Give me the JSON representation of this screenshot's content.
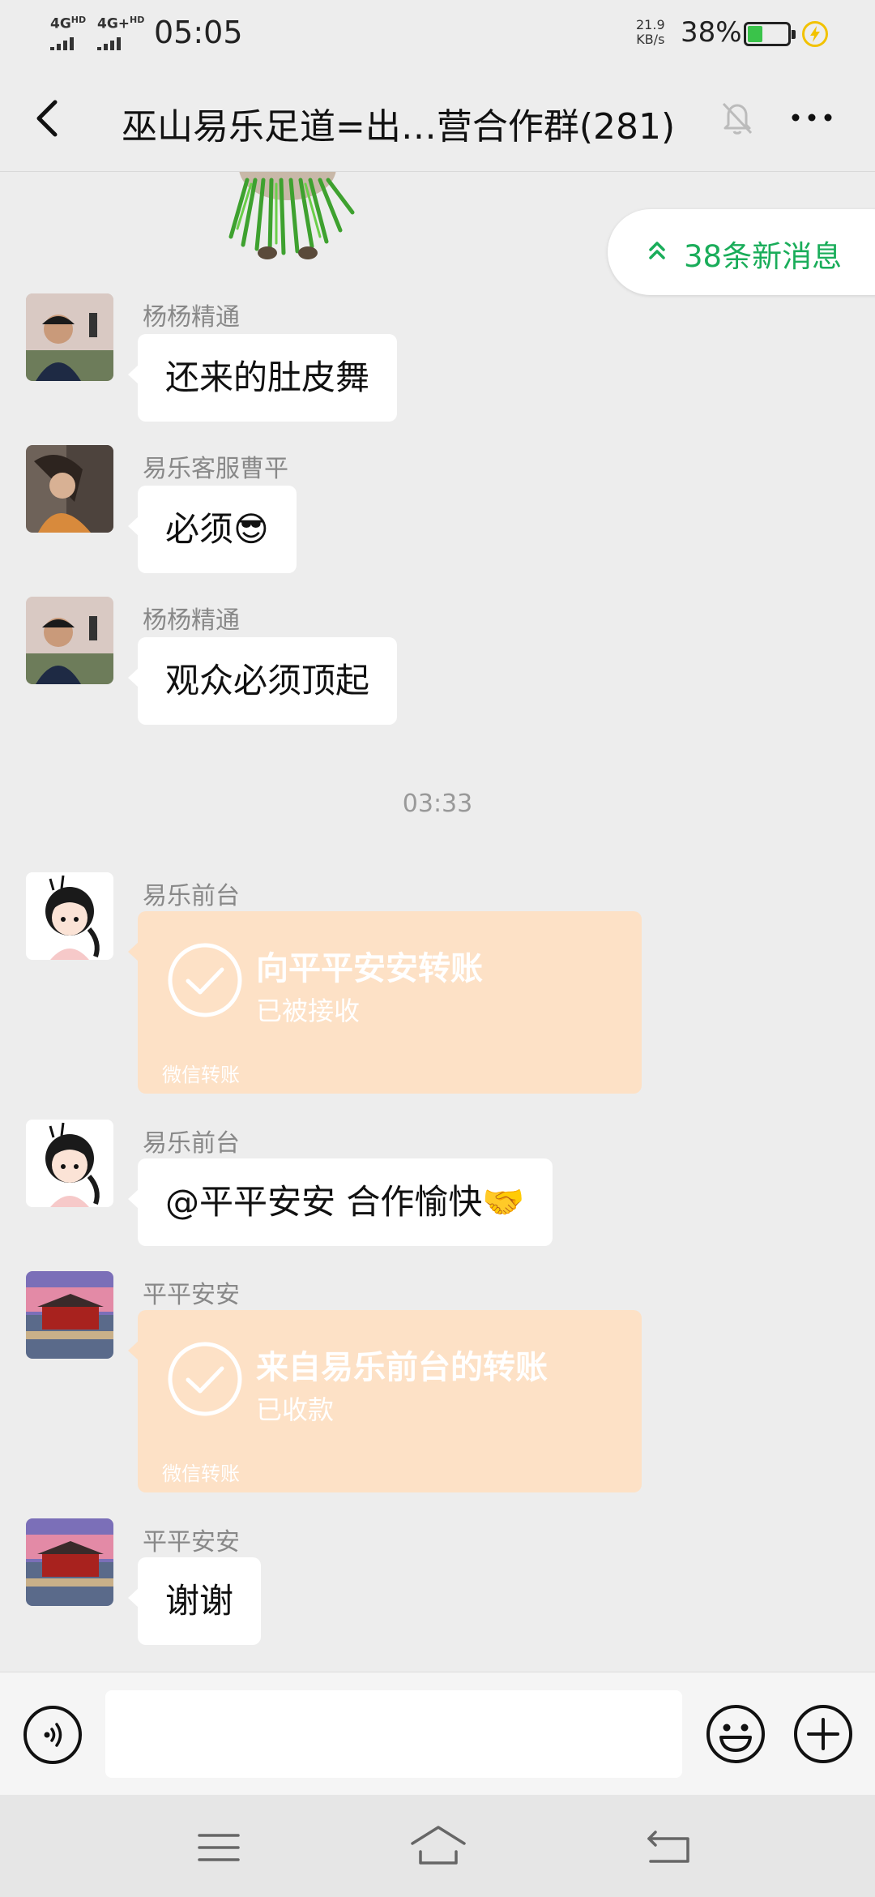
{
  "status_bar": {
    "signal1": "4G",
    "signal1_sup": "HD",
    "signal2": "4G+",
    "signal2_sup": "HD",
    "time": "05:05",
    "net_speed_value": "21.9",
    "net_speed_unit": "KB/s",
    "battery_percent": "38%",
    "battery_level": 0.38,
    "charging": true
  },
  "header": {
    "title": "巫山易乐足道=出…营合作群(281)",
    "back_icon": "chevron-left-icon",
    "mute_icon": "bell-off-icon",
    "more_icon": "more-dots-icon"
  },
  "new_messages": {
    "label": "38条新消息",
    "icon": "double-chevron-up-icon",
    "color": "#1aad5a"
  },
  "messages": [
    {
      "sender": "杨杨精通",
      "text": "还来的肚皮舞"
    },
    {
      "sender": "易乐客服曹平",
      "text": "必须😎"
    },
    {
      "sender": "杨杨精通",
      "text": "观众必须顶起"
    },
    {
      "sender": "易乐前台",
      "transfer_title": "向平平安安转账",
      "transfer_status": "已被接收",
      "transfer_footer": "微信转账"
    },
    {
      "sender": "易乐前台",
      "text": "@平平安安 合作愉快🤝"
    },
    {
      "sender": "平平安安",
      "transfer_title": "来自易乐前台的转账",
      "transfer_status": "已收款",
      "transfer_footer": "微信转账"
    },
    {
      "sender": "平平安安",
      "text": "谢谢"
    }
  ],
  "timestamp": "03:33",
  "input_bar": {
    "voice_icon": "voice-icon",
    "emoji_icon": "emoji-icon",
    "plus_icon": "plus-icon",
    "value": ""
  },
  "nav_bar": {
    "menu_icon": "menu-icon",
    "home_icon": "home-icon",
    "back_icon": "back-icon"
  },
  "colors": {
    "background": "#ededed",
    "transfer_bubble": "#fde1c6",
    "accent_green": "#1aad5a",
    "battery_green": "#3ac34a"
  }
}
